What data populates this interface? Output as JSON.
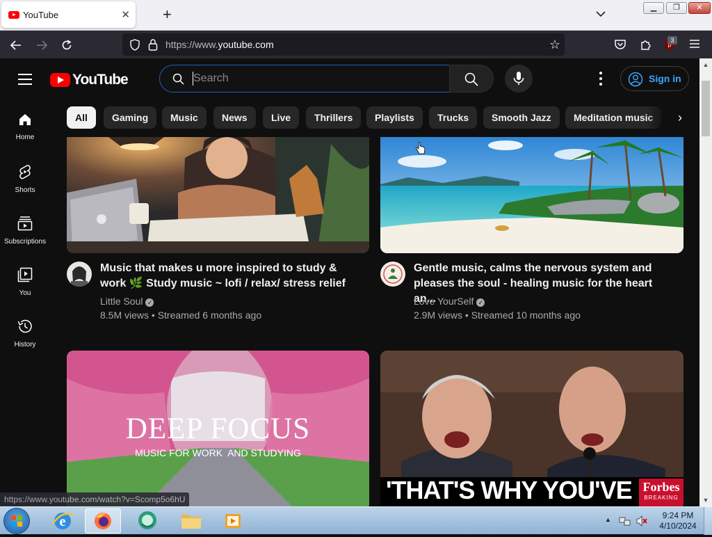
{
  "browser": {
    "tab_title": "YouTube",
    "tab_close": "✕",
    "new_tab": "+",
    "url_prefix": "https://www.",
    "url_domain": "youtube.com",
    "extension_badge": "3",
    "status_link": "https://www.youtube.com/watch?v=Scomp5o6hU"
  },
  "header": {
    "logo_text": "YouTube",
    "search_placeholder": "Search",
    "signin_label": "Sign in"
  },
  "guide": [
    {
      "label": "Home",
      "icon": "home-icon"
    },
    {
      "label": "Shorts",
      "icon": "shorts-icon"
    },
    {
      "label": "Subscriptions",
      "icon": "subscriptions-icon"
    },
    {
      "label": "You",
      "icon": "you-icon"
    },
    {
      "label": "History",
      "icon": "history-icon"
    }
  ],
  "chips": [
    "All",
    "Gaming",
    "Music",
    "News",
    "Live",
    "Thrillers",
    "Playlists",
    "Trucks",
    "Smooth Jazz",
    "Meditation music"
  ],
  "videos": [
    {
      "title": "Music that makes u more inspired to study & work 🌿 Study music ~ lofi / relax/ stress relief",
      "channel": "Little Soul",
      "meta": "8.5M views • Streamed 6 months ago"
    },
    {
      "title": "Gentle music, calms the nervous system and pleases the soul - healing music for the heart an...",
      "channel": "Love YourSelf",
      "meta": "2.9M views • Streamed 10 months ago"
    },
    {
      "thumb_title": "DEEP FOCUS",
      "thumb_subtitle": "MUSIC FOR WORK  AND STUDYING"
    },
    {
      "thumb_caption": "'THAT'S WHY YOU'VE",
      "brand": "Forbes",
      "brand_sub": "BREAKING"
    }
  ],
  "taskbar": {
    "time": "9:24 PM",
    "date": "4/10/2024"
  },
  "colors": {
    "yt_red": "#ff0000",
    "link_blue": "#3ea6ff",
    "bg": "#0f0f0f"
  }
}
